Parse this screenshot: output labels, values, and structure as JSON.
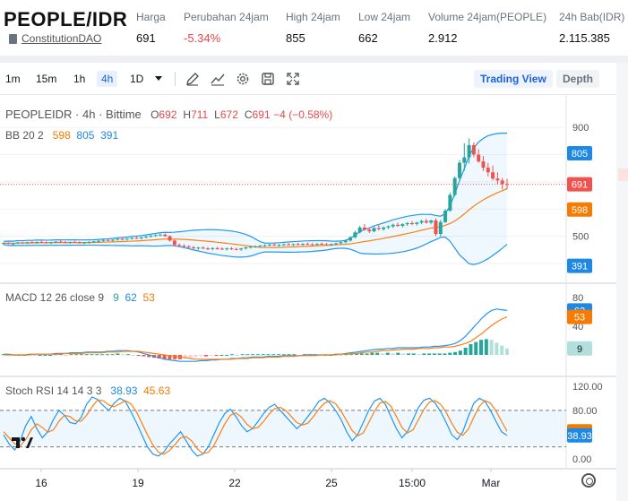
{
  "ticker": {
    "pair": "PEOPLE/IDR",
    "project": "ConstitutionDAO",
    "stats": [
      {
        "label": "Harga",
        "value": "691",
        "negative": false
      },
      {
        "label": "Perubahan 24jam",
        "value": "-5.34%",
        "negative": true
      },
      {
        "label": "High 24jam",
        "value": "855",
        "negative": false
      },
      {
        "label": "Low 24jam",
        "value": "662",
        "negative": false
      },
      {
        "label": "Volume 24jam(PEOPLE)",
        "value": "2.912",
        "negative": false
      },
      {
        "label": "24h Bab(IDR)",
        "value": "2.115.385",
        "negative": false
      }
    ]
  },
  "toolbar": {
    "timeframes": [
      "1m",
      "15m",
      "1h",
      "4h",
      "1D"
    ],
    "active_timeframe": "4h",
    "icons": [
      "draw-pen-icon",
      "indicators-icon",
      "settings-icon",
      "save-icon",
      "fullscreen-icon"
    ],
    "trading_view_label": "Trading View",
    "depth_label": "Depth"
  },
  "legend": {
    "symbol": "PEOPLEIDR",
    "interval": "4h",
    "exchange": "Bittime",
    "o": "692",
    "h": "711",
    "l": "672",
    "c": "691",
    "change": "−4 (−0.58%)",
    "bb_label": "BB 20 2",
    "bb_basis": "598",
    "bb_upper": "805",
    "bb_lower": "391",
    "macd_label": "MACD 12 26 close 9",
    "macd_hist": "9",
    "macd_line": "62",
    "macd_signal": "53",
    "stoch_label": "Stoch RSI 14 14 3 3",
    "stoch_k": "38.93",
    "stoch_d": "45.63"
  },
  "colors": {
    "up": "#26a69a",
    "down": "#ef5350",
    "bb_band": "#2196f3",
    "bb_basis": "#ff7f0e",
    "macd": "#2196f3",
    "signal": "#ff7f0e",
    "accent": "#1e63d6"
  },
  "price_axis": {
    "ticks": [
      900,
      800,
      700,
      600,
      500,
      400
    ],
    "price_badge": "691",
    "upper_badge": "805",
    "basis_badge": "598",
    "lower_badge": "391"
  },
  "macd_axis": {
    "ticks": [
      "80",
      "40"
    ],
    "macd_badge": "62",
    "signal_badge": "53",
    "hist_badge": "9"
  },
  "stoch_axis": {
    "ticks": [
      "120.00",
      "80.00",
      "0.00"
    ],
    "k_badge": "38.93",
    "d_badge": "45.63"
  },
  "time_axis": [
    "16",
    "19",
    "22",
    "25",
    "15:00",
    "Mar"
  ],
  "chart_data": [
    {
      "type": "candlestick",
      "title": "PEOPLEIDR · 4h · Bittime",
      "ylim": [
        360,
        960
      ],
      "candles": [
        [
          472,
          477,
          468,
          475
        ],
        [
          475,
          478,
          471,
          473
        ],
        [
          473,
          476,
          469,
          474
        ],
        [
          474,
          479,
          472,
          477
        ],
        [
          477,
          480,
          473,
          475
        ],
        [
          475,
          479,
          471,
          478
        ],
        [
          478,
          482,
          474,
          476
        ],
        [
          476,
          480,
          472,
          479
        ],
        [
          479,
          483,
          475,
          477
        ],
        [
          477,
          481,
          473,
          475
        ],
        [
          475,
          479,
          471,
          478
        ],
        [
          478,
          482,
          474,
          480
        ],
        [
          480,
          484,
          476,
          478
        ],
        [
          478,
          482,
          474,
          476
        ],
        [
          476,
          480,
          472,
          479
        ],
        [
          479,
          483,
          475,
          477
        ],
        [
          477,
          481,
          473,
          475
        ],
        [
          475,
          479,
          471,
          477
        ],
        [
          477,
          481,
          473,
          479
        ],
        [
          479,
          483,
          475,
          481
        ],
        [
          481,
          486,
          477,
          483
        ],
        [
          483,
          488,
          479,
          486
        ],
        [
          486,
          490,
          482,
          484
        ],
        [
          484,
          489,
          480,
          487
        ],
        [
          487,
          492,
          483,
          490
        ],
        [
          490,
          494,
          486,
          488
        ],
        [
          488,
          493,
          484,
          491
        ],
        [
          491,
          496,
          487,
          494
        ],
        [
          494,
          499,
          490,
          492
        ],
        [
          492,
          497,
          488,
          496
        ],
        [
          496,
          501,
          492,
          499
        ],
        [
          499,
          504,
          495,
          502
        ],
        [
          502,
          507,
          498,
          504
        ],
        [
          504,
          509,
          500,
          506
        ],
        [
          506,
          510,
          498,
          500
        ],
        [
          500,
          503,
          480,
          484
        ],
        [
          484,
          488,
          462,
          468
        ],
        [
          468,
          473,
          460,
          465
        ],
        [
          465,
          470,
          458,
          462
        ],
        [
          462,
          467,
          455,
          459
        ],
        [
          459,
          464,
          452,
          456
        ],
        [
          456,
          461,
          450,
          458
        ],
        [
          458,
          463,
          452,
          455
        ],
        [
          455,
          460,
          449,
          453
        ],
        [
          453,
          459,
          448,
          456
        ],
        [
          456,
          461,
          450,
          454
        ],
        [
          454,
          459,
          449,
          452
        ],
        [
          452,
          458,
          447,
          455
        ],
        [
          455,
          460,
          449,
          453
        ],
        [
          453,
          458,
          448,
          451
        ],
        [
          451,
          457,
          446,
          455
        ],
        [
          455,
          461,
          451,
          459
        ],
        [
          459,
          464,
          455,
          461
        ],
        [
          461,
          466,
          457,
          463
        ],
        [
          463,
          468,
          459,
          465
        ],
        [
          465,
          470,
          461,
          467
        ],
        [
          467,
          472,
          463,
          469
        ],
        [
          469,
          474,
          465,
          466
        ],
        [
          466,
          471,
          462,
          468
        ],
        [
          468,
          473,
          464,
          470
        ],
        [
          470,
          475,
          466,
          468
        ],
        [
          468,
          473,
          464,
          471
        ],
        [
          471,
          476,
          467,
          469
        ],
        [
          469,
          474,
          465,
          472
        ],
        [
          472,
          477,
          468,
          470
        ],
        [
          470,
          475,
          466,
          469
        ],
        [
          469,
          474,
          465,
          472
        ],
        [
          472,
          477,
          468,
          470
        ],
        [
          470,
          475,
          466,
          468
        ],
        [
          468,
          473,
          464,
          471
        ],
        [
          471,
          476,
          467,
          474
        ],
        [
          474,
          480,
          470,
          478
        ],
        [
          478,
          486,
          474,
          484
        ],
        [
          484,
          500,
          480,
          496
        ],
        [
          496,
          520,
          492,
          514
        ],
        [
          514,
          538,
          510,
          532
        ],
        [
          532,
          545,
          520,
          524
        ],
        [
          524,
          530,
          512,
          518
        ],
        [
          518,
          534,
          514,
          530
        ],
        [
          530,
          540,
          522,
          526
        ],
        [
          526,
          536,
          520,
          532
        ],
        [
          532,
          540,
          526,
          536
        ],
        [
          536,
          546,
          530,
          542
        ],
        [
          542,
          550,
          534,
          538
        ],
        [
          538,
          548,
          532,
          544
        ],
        [
          544,
          552,
          538,
          548
        ],
        [
          548,
          556,
          540,
          545
        ],
        [
          545,
          553,
          539,
          550
        ],
        [
          550,
          560,
          544,
          556
        ],
        [
          556,
          564,
          546,
          550
        ],
        [
          550,
          560,
          544,
          558
        ],
        [
          558,
          566,
          500,
          508
        ],
        [
          508,
          560,
          500,
          552
        ],
        [
          552,
          600,
          548,
          594
        ],
        [
          594,
          660,
          590,
          652
        ],
        [
          652,
          720,
          646,
          714
        ],
        [
          714,
          780,
          706,
          770
        ],
        [
          770,
          842,
          740,
          790
        ],
        [
          790,
          860,
          768,
          835
        ],
        [
          835,
          845,
          790,
          800
        ],
        [
          800,
          820,
          770,
          775
        ],
        [
          775,
          795,
          740,
          752
        ],
        [
          752,
          770,
          720,
          735
        ],
        [
          735,
          760,
          705,
          712
        ],
        [
          712,
          735,
          690,
          705
        ],
        [
          705,
          715,
          672,
          692
        ],
        [
          692,
          711,
          672,
          691
        ]
      ]
    },
    {
      "type": "line",
      "title": "MACD 12 26 close 9",
      "ylim": [
        -25,
        90
      ],
      "series": [
        {
          "name": "MACD",
          "values": [
            1,
            1,
            0,
            0,
            0,
            1,
            1,
            1,
            1,
            1,
            2,
            2,
            2,
            3,
            3,
            3,
            4,
            4,
            4,
            4,
            5,
            5,
            6,
            6,
            6,
            5,
            4,
            2,
            0,
            -2,
            -4,
            -6,
            -7,
            -8,
            -9,
            -9,
            -9,
            -9,
            -8,
            -8,
            -7,
            -7,
            -6,
            -6,
            -5,
            -5,
            -4,
            -4,
            -3,
            -3,
            -3,
            -2,
            -2,
            -2,
            -1,
            -1,
            -1,
            -1,
            0,
            0,
            0,
            0,
            0,
            0,
            1,
            1,
            2,
            3,
            4,
            5,
            6,
            7,
            8,
            8,
            9,
            9,
            10,
            10,
            10,
            10,
            10,
            11,
            11,
            12,
            12,
            13,
            14,
            16,
            20,
            26,
            34,
            42,
            50,
            57,
            62,
            64,
            63,
            62
          ]
        },
        {
          "name": "Signal",
          "values": [
            0,
            0,
            0,
            0,
            0,
            0,
            1,
            1,
            1,
            1,
            1,
            1,
            2,
            2,
            2,
            2,
            3,
            3,
            3,
            3,
            4,
            4,
            4,
            5,
            5,
            5,
            5,
            4,
            3,
            2,
            1,
            0,
            -1,
            -2,
            -3,
            -4,
            -5,
            -6,
            -6,
            -6,
            -6,
            -6,
            -6,
            -6,
            -6,
            -5,
            -5,
            -5,
            -4,
            -4,
            -4,
            -3,
            -3,
            -3,
            -2,
            -2,
            -2,
            -1,
            -1,
            -1,
            -1,
            0,
            0,
            0,
            0,
            1,
            1,
            2,
            2,
            3,
            4,
            4,
            5,
            6,
            6,
            7,
            7,
            8,
            8,
            8,
            9,
            9,
            9,
            10,
            10,
            11,
            11,
            12,
            14,
            16,
            19,
            24,
            29,
            35,
            41,
            46,
            50,
            53
          ]
        }
      ],
      "histogram": [
        1,
        1,
        0,
        0,
        0,
        1,
        0,
        0,
        0,
        0,
        1,
        1,
        0,
        1,
        1,
        1,
        1,
        1,
        1,
        1,
        1,
        1,
        2,
        1,
        1,
        0,
        -1,
        -2,
        -3,
        -4,
        -5,
        -6,
        -6,
        -6,
        -6,
        -5,
        -4,
        -3,
        -2,
        -2,
        -1,
        -1,
        0,
        0,
        1,
        0,
        1,
        1,
        1,
        1,
        1,
        1,
        1,
        1,
        1,
        1,
        1,
        0,
        1,
        1,
        1,
        0,
        0,
        0,
        1,
        0,
        1,
        1,
        2,
        2,
        2,
        3,
        3,
        2,
        3,
        2,
        3,
        2,
        2,
        2,
        1,
        2,
        2,
        2,
        2,
        2,
        3,
        4,
        6,
        10,
        15,
        18,
        21,
        22,
        21,
        17,
        13,
        9
      ]
    },
    {
      "type": "line",
      "title": "Stoch RSI 14 14 3 3",
      "ylim": [
        -10,
        130
      ],
      "series": [
        {
          "name": "K",
          "values": [
            40,
            25,
            15,
            30,
            55,
            70,
            50,
            35,
            45,
            65,
            80,
            72,
            60,
            58,
            68,
            90,
            102,
            98,
            88,
            80,
            92,
            100,
            95,
            78,
            60,
            40,
            20,
            8,
            5,
            12,
            25,
            35,
            45,
            30,
            15,
            5,
            8,
            20,
            40,
            60,
            75,
            82,
            70,
            55,
            45,
            50,
            62,
            75,
            85,
            90,
            80,
            70,
            60,
            50,
            58,
            70,
            82,
            95,
            100,
            92,
            80,
            65,
            45,
            30,
            40,
            60,
            80,
            95,
            100,
            90,
            70,
            50,
            35,
            45,
            65,
            85,
            97,
            100,
            92,
            78,
            60,
            40,
            32,
            45,
            70,
            92,
            100,
            95,
            80,
            62,
            45,
            38.93
          ]
        },
        {
          "name": "D",
          "values": [
            45,
            35,
            25,
            22,
            32,
            48,
            58,
            52,
            44,
            48,
            62,
            72,
            70,
            63,
            62,
            72,
            86,
            97,
            96,
            89,
            86,
            91,
            96,
            91,
            78,
            59,
            40,
            23,
            11,
            8,
            14,
            24,
            35,
            37,
            30,
            17,
            9,
            11,
            22,
            40,
            58,
            72,
            76,
            69,
            57,
            50,
            52,
            62,
            74,
            83,
            85,
            80,
            70,
            60,
            56,
            59,
            70,
            82,
            92,
            96,
            91,
            79,
            63,
            47,
            38,
            43,
            60,
            78,
            92,
            95,
            87,
            70,
            52,
            43,
            48,
            65,
            82,
            94,
            96,
            90,
            77,
            59,
            44,
            39,
            49,
            69,
            87,
            96,
            92,
            79,
            62,
            45.63
          ]
        }
      ]
    }
  ]
}
